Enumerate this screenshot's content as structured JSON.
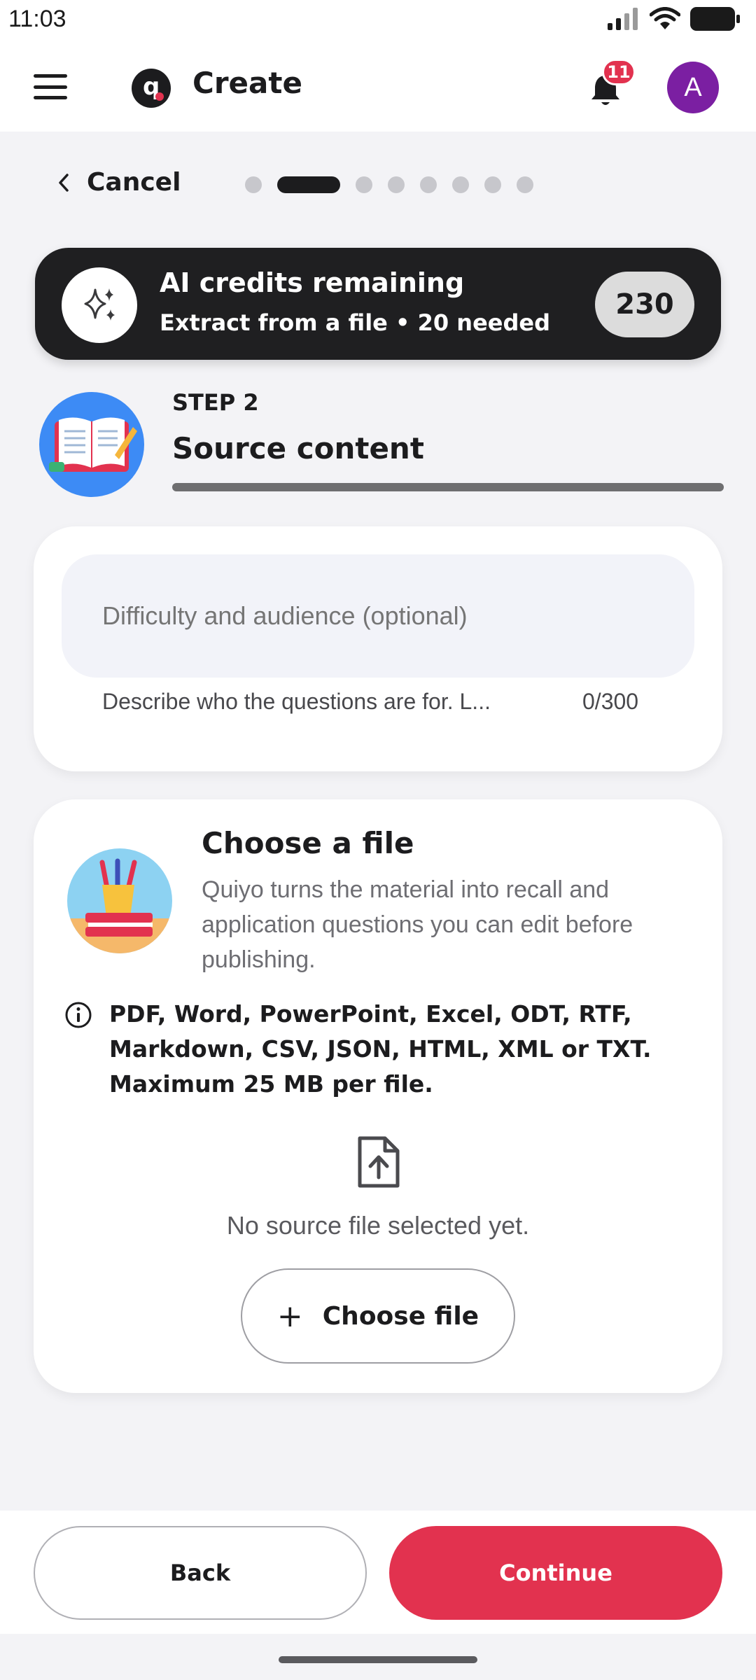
{
  "status_bar": {
    "time": "11:03"
  },
  "header": {
    "title": "Create",
    "notification_count": "11",
    "avatar_initial": "A"
  },
  "nav": {
    "cancel_label": "Cancel",
    "total_steps": 8,
    "current_step": 2
  },
  "credits": {
    "title": "AI credits remaining",
    "subtitle": "Extract from a file • 20 needed",
    "remaining": "230"
  },
  "step": {
    "label": "STEP 2",
    "title": "Source content"
  },
  "difficulty": {
    "placeholder": "Difficulty and audience (optional)",
    "value": "",
    "helper": "Describe who the questions are for. L...",
    "counter": "0/300"
  },
  "file_section": {
    "title": "Choose a file",
    "description": "Quiyo turns the material into recall and application questions you can edit before publishing.",
    "formats_line1": "PDF, Word, PowerPoint, Excel, ODT, RTF,",
    "formats_line2": "Markdown, CSV, JSON, HTML, XML or TXT.",
    "formats_line3": "Maximum 25 MB per file.",
    "empty_state": "No source file selected yet.",
    "choose_button": "Choose file"
  },
  "footer": {
    "back_label": "Back",
    "continue_label": "Continue"
  },
  "colors": {
    "accent": "#e2324f",
    "dark": "#1f1f21",
    "avatar": "#7b1fa2",
    "background": "#f3f3f6"
  },
  "icons": [
    "hamburger-icon",
    "app-logo",
    "bell-icon",
    "chevron-left-icon",
    "sparkles-icon",
    "info-icon",
    "file-upload-icon",
    "plus-icon",
    "signal-icon",
    "wifi-icon",
    "battery-icon"
  ]
}
